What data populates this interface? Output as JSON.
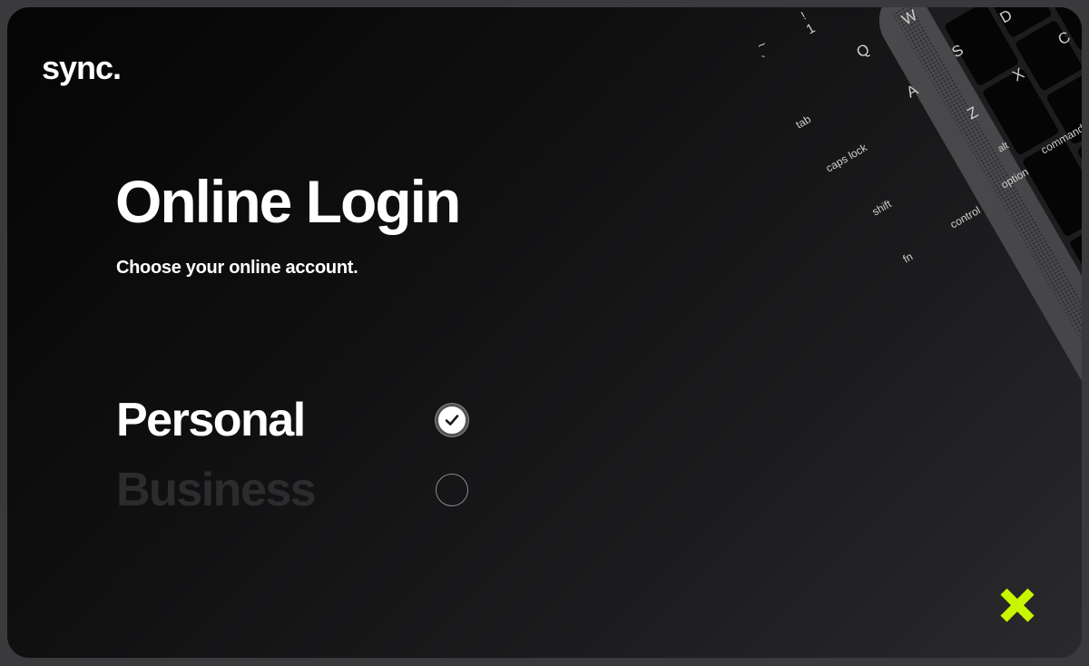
{
  "brand": {
    "logo_text": "sync."
  },
  "main": {
    "title": "Online Login",
    "subtitle": "Choose your online account."
  },
  "account_options": [
    {
      "label": "Personal",
      "selected": true
    },
    {
      "label": "Business",
      "selected": false
    }
  ],
  "keyboard": {
    "keys": [
      "~",
      "`",
      "!",
      "1",
      "Q",
      "W",
      "S",
      "D",
      "C",
      "A",
      "X",
      "Z",
      "tab",
      "caps lock",
      "shift",
      "control",
      "option",
      "alt",
      "command",
      "fn"
    ]
  },
  "colors": {
    "accent": "#c8f500",
    "background": "#0b0b0c",
    "text": "#ffffff",
    "muted": "#2c2c2e"
  },
  "icons": {
    "check": "checkmark-icon",
    "close": "close-icon"
  }
}
